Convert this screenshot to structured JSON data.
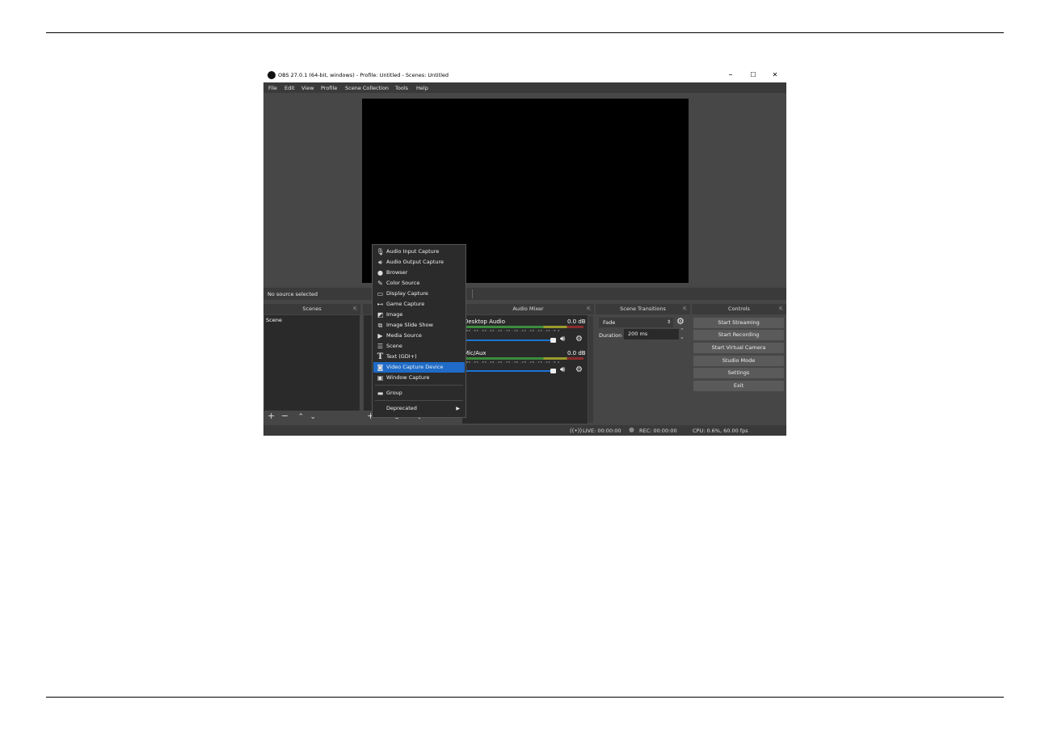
{
  "window": {
    "title": "OBS 27.0.1 (64-bit, windows) - Profile: Untitled - Scenes: Untitled",
    "minimize": "–",
    "maximize": "☐",
    "close": "✕"
  },
  "menubar": [
    "File",
    "Edit",
    "View",
    "Profile",
    "Scene Collection",
    "Tools",
    "Help"
  ],
  "source_bar": {
    "label": "No source selected"
  },
  "docks": {
    "scenes": {
      "title": "Scenes",
      "items": [
        "Scene"
      ]
    },
    "audio_mixer": {
      "title": "Audio Mixer",
      "channels": [
        {
          "name": "Desktop Audio",
          "level": "0.0 dB"
        },
        {
          "name": "Mic/Aux",
          "level": "0.0 dB"
        }
      ],
      "ticks": "-60 -55 -50 -45 -40 -35 -30 -25 -20 -15 -10 -5 0"
    },
    "scene_transitions": {
      "title": "Scene Transitions",
      "transition": "Fade",
      "duration_label": "Duration",
      "duration_value": "200 ms"
    },
    "controls": {
      "title": "Controls",
      "buttons": [
        "Start Streaming",
        "Start Recording",
        "Start Virtual Camera",
        "Studio Mode",
        "Settings",
        "Exit"
      ]
    }
  },
  "source_menu": {
    "items": [
      {
        "label": "Audio Input Capture",
        "icon": "microphone-icon"
      },
      {
        "label": "Audio Output Capture",
        "icon": "speaker-icon"
      },
      {
        "label": "Browser",
        "icon": "globe-icon"
      },
      {
        "label": "Color Source",
        "icon": "brush-icon"
      },
      {
        "label": "Display Capture",
        "icon": "monitor-icon"
      },
      {
        "label": "Game Capture",
        "icon": "gamepad-icon"
      },
      {
        "label": "Image",
        "icon": "image-icon"
      },
      {
        "label": "Image Slide Show",
        "icon": "slideshow-icon"
      },
      {
        "label": "Media Source",
        "icon": "play-icon"
      },
      {
        "label": "Scene",
        "icon": "list-icon"
      },
      {
        "label": "Text (GDI+)",
        "icon": "text-icon"
      },
      {
        "label": "Video Capture Device",
        "icon": "camera-icon"
      },
      {
        "label": "Window Capture",
        "icon": "window-icon"
      },
      {
        "label": "Group",
        "icon": "folder-icon"
      },
      {
        "label": "Deprecated",
        "icon": "submenu-arrow-icon"
      }
    ],
    "selected": "Video Capture Device"
  },
  "status": {
    "live": "LIVE: 00:00:00",
    "rec": "REC: 00:00:00",
    "cpu": "CPU: 0.6%, 60.00 fps"
  }
}
